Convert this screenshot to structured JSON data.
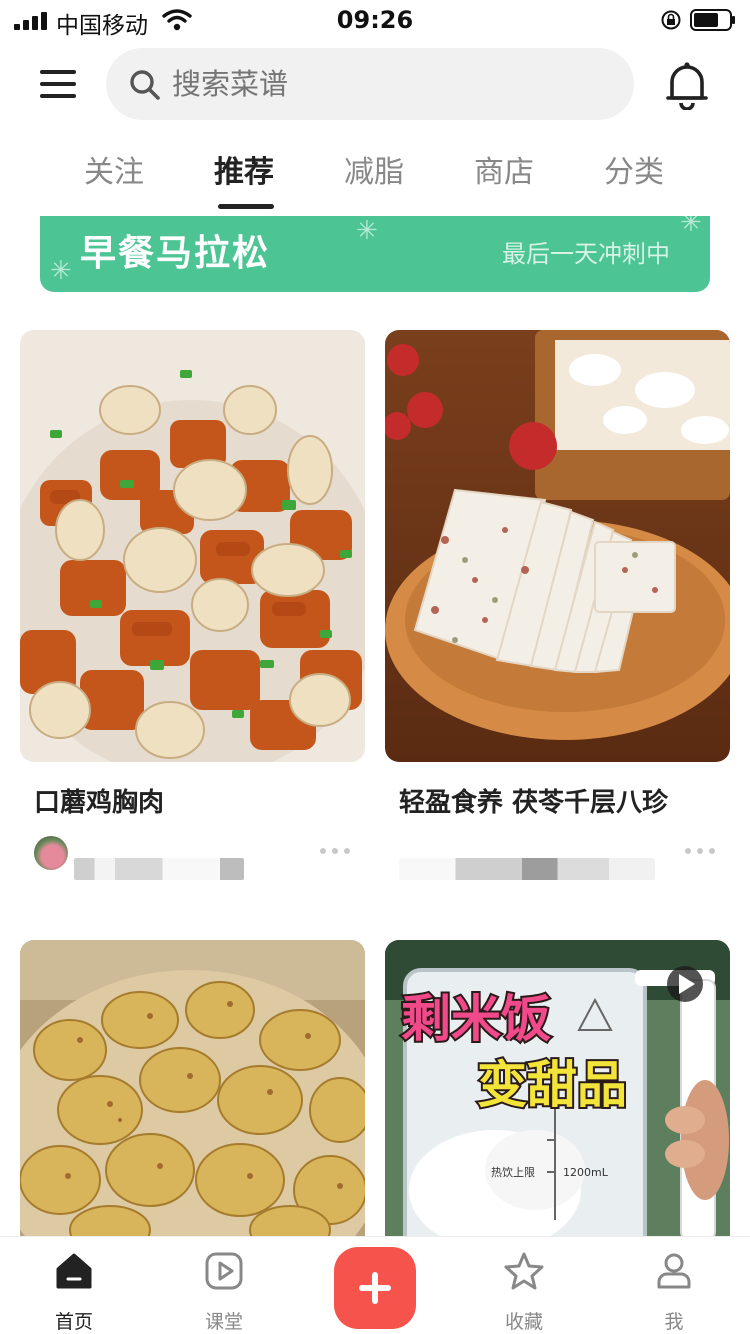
{
  "status_bar": {
    "carrier": "中国移动",
    "time": "09:26"
  },
  "header": {
    "search_placeholder": "搜索菜谱"
  },
  "tabs": [
    {
      "label": "关注"
    },
    {
      "label": "推荐",
      "active": true
    },
    {
      "label": "减脂"
    },
    {
      "label": "商店"
    },
    {
      "label": "分类"
    }
  ],
  "banner": {
    "title": "早餐马拉松",
    "subtitle": "最后一天冲刺中",
    "color": "#4cc494"
  },
  "feed": [
    {
      "title": "口蘑鸡胸肉",
      "image": "braised-chicken-breast-with-mushrooms"
    },
    {
      "title": "轻盈食养 茯苓千层八珍",
      "image": "layered-poria-cake-on-wooden-plate"
    },
    {
      "title": "",
      "image": "spiced-roasted-potatoes"
    },
    {
      "title": "",
      "image": "blender-with-rice-video",
      "overlay_line1": "剩米饭",
      "overlay_line2": "变甜品",
      "jar_marking": "热饮上限",
      "jar_volume": "1200mL"
    }
  ],
  "tabbar": {
    "items": [
      {
        "label": "首页",
        "icon": "home-icon",
        "active": true
      },
      {
        "label": "课堂",
        "icon": "play-icon"
      },
      {
        "label": "",
        "icon": "plus-icon"
      },
      {
        "label": "收藏",
        "icon": "star-icon"
      },
      {
        "label": "我",
        "icon": "person-icon"
      }
    ],
    "add_color": "#f5534b"
  }
}
